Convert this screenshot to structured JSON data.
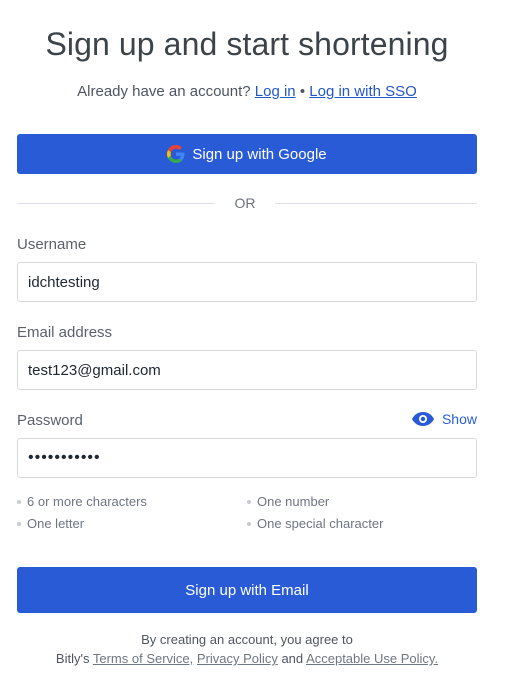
{
  "header": {
    "title": "Sign up and start shortening",
    "already_text": "Already have an account?",
    "login_link": "Log in",
    "separator": "•",
    "sso_link": "Log in with SSO"
  },
  "google_button": {
    "label": "Sign up with Google",
    "icon": "google-icon"
  },
  "divider": {
    "text": "OR"
  },
  "form": {
    "username": {
      "label": "Username",
      "value": "idchtesting"
    },
    "email": {
      "label": "Email address",
      "value": "test123@gmail.com"
    },
    "password": {
      "label": "Password",
      "value": "•••••••••••",
      "show_label": "Show",
      "show_icon": "eye-icon"
    }
  },
  "requirements": [
    "6 or more characters",
    "One number",
    "One letter",
    "One special character"
  ],
  "submit_button": {
    "label": "Sign up with Email"
  },
  "terms": {
    "line1": "By creating an account, you agree to",
    "prefix": "Bitly's",
    "tos_link": "Terms of Service,",
    "privacy_link": "Privacy Policy",
    "and_text": "and",
    "aup_link": "Acceptable Use Policy."
  },
  "colors": {
    "primary": "#2a5bd7",
    "link": "#2356c8",
    "border": "#d5d9de"
  }
}
